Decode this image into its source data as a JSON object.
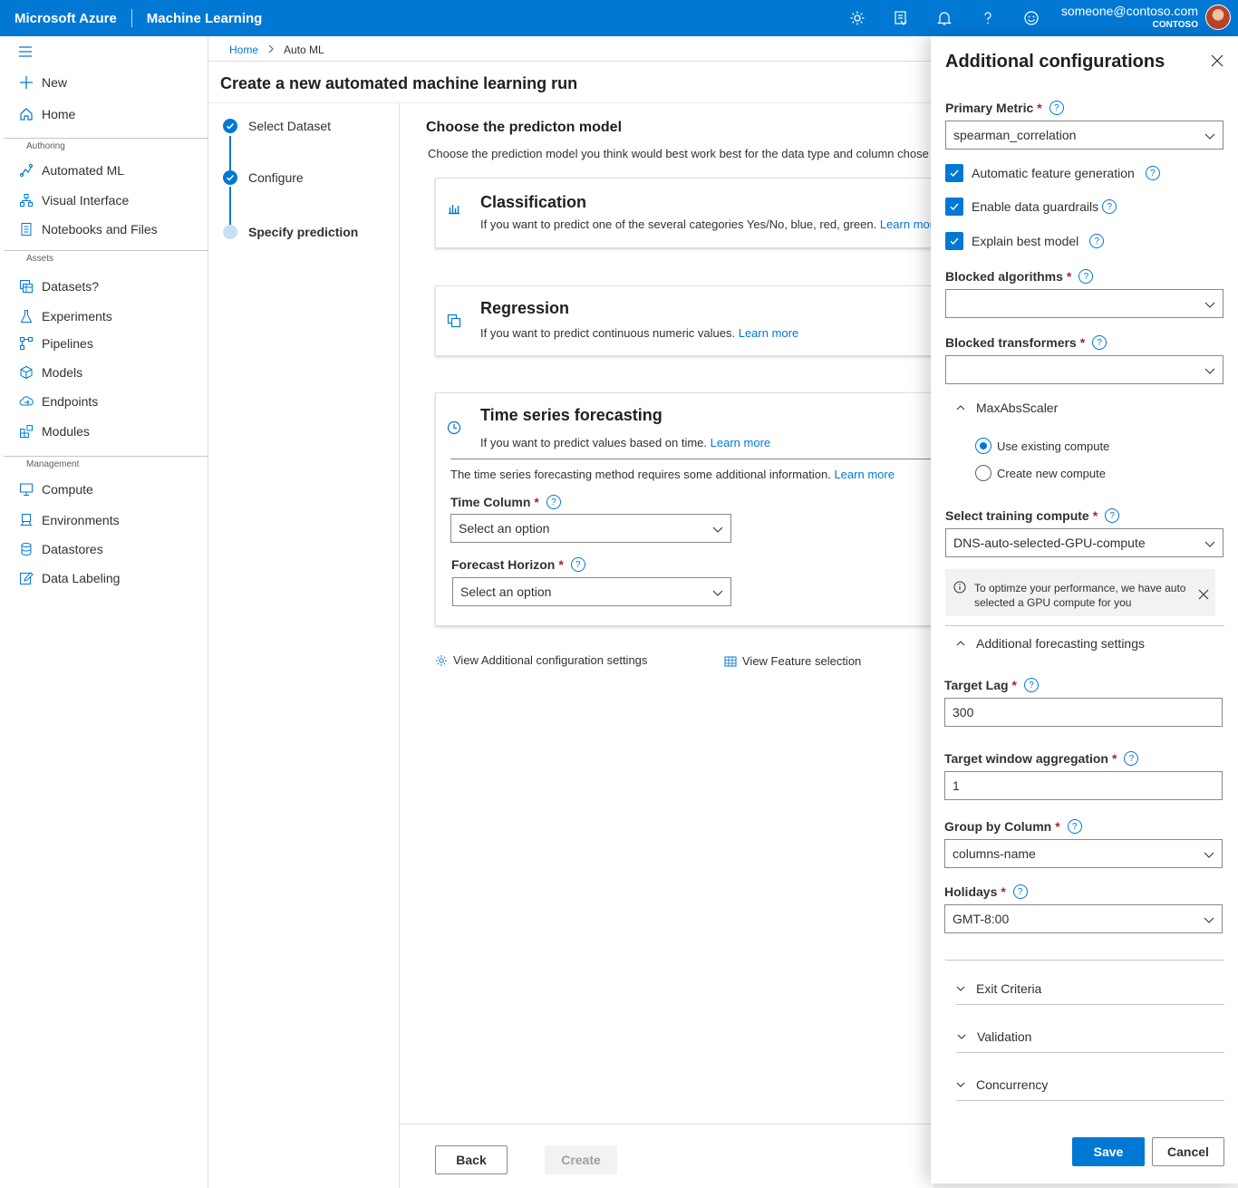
{
  "topbar": {
    "brand": "Microsoft Azure",
    "product": "Machine Learning",
    "user_email": "someone@contoso.com",
    "user_org": "CONTOSO",
    "brand_color": "#0078d4"
  },
  "nav": {
    "new": "New",
    "home": "Home",
    "authoring_header": "Authoring",
    "automated_ml": "Automated ML",
    "visual_interface": "Visual Interface",
    "notebooks": "Notebooks and Files",
    "assets_header": "Assets",
    "datasets": "Datasets?",
    "experiments": "Experiments",
    "pipelines": "Pipelines",
    "models": "Models",
    "endpoints": "Endpoints",
    "modules": "Modules",
    "management_header": "Management",
    "compute": "Compute",
    "environments": "Environments",
    "datastores": "Datastores",
    "data_labeling": "Data Labeling"
  },
  "breadcrumb": {
    "home": "Home",
    "current": "Auto ML"
  },
  "page_title": "Create a new automated machine learning run",
  "steps": [
    "Select Dataset",
    "Configure",
    "Specify prediction"
  ],
  "content": {
    "title": "Choose the predicton model",
    "description": "Choose the prediction model you think would best work best for the data type and column chose",
    "classification": {
      "title": "Classification",
      "desc": "If you want to predict one of the several categories Yes/No, blue, red, green.",
      "link": "Learn mor"
    },
    "regression": {
      "title": "Regression",
      "desc": "If you want to predict continuous numeric values.",
      "link": "Learn more"
    },
    "timeseries": {
      "title": "Time series forecasting",
      "desc": "If you want to predict values based on time.",
      "link": "Learn more",
      "info": "The time series forecasting method requires some additional information.",
      "info_link": "Learn more",
      "time_column_label": "Time Column",
      "time_column_value": "Select an option",
      "forecast_horizon_label": "Forecast Horizon",
      "forecast_horizon_value": "Select an option"
    },
    "view_additional": "View Additional configuration settings",
    "view_feature": "View Feature selection"
  },
  "footer": {
    "back": "Back",
    "create": "Create"
  },
  "panel": {
    "title": "Additional configurations",
    "primary_metric_label": "Primary Metric",
    "primary_metric_value": "spearman_correlation",
    "auto_feature": "Automatic feature generation",
    "guardrails": "Enable data guardrails",
    "explain": "Explain best model",
    "blocked_algorithms_label": "Blocked algorithms",
    "blocked_transformers_label": "Blocked transformers",
    "maxabs": "MaxAbsScaler",
    "use_existing": "Use existing compute",
    "create_new": "Create new compute",
    "training_compute_label": "Select training compute",
    "training_compute_value": "DNS-auto-selected-GPU-compute",
    "info_text": "To optimze your performance, we have auto selected a GPU compute for you",
    "forecast_settings": "Additional forecasting settings",
    "target_lag_label": "Target Lag",
    "target_lag_value": "300",
    "target_window_label": "Target window aggregation",
    "target_window_value": "1",
    "group_by_label": "Group by Column",
    "group_by_value": "columns-name",
    "holidays_label": "Holidays",
    "holidays_value": "GMT-8:00",
    "exit_criteria": "Exit Criteria",
    "validation": "Validation",
    "concurrency": "Concurrency",
    "save": "Save",
    "cancel": "Cancel"
  }
}
